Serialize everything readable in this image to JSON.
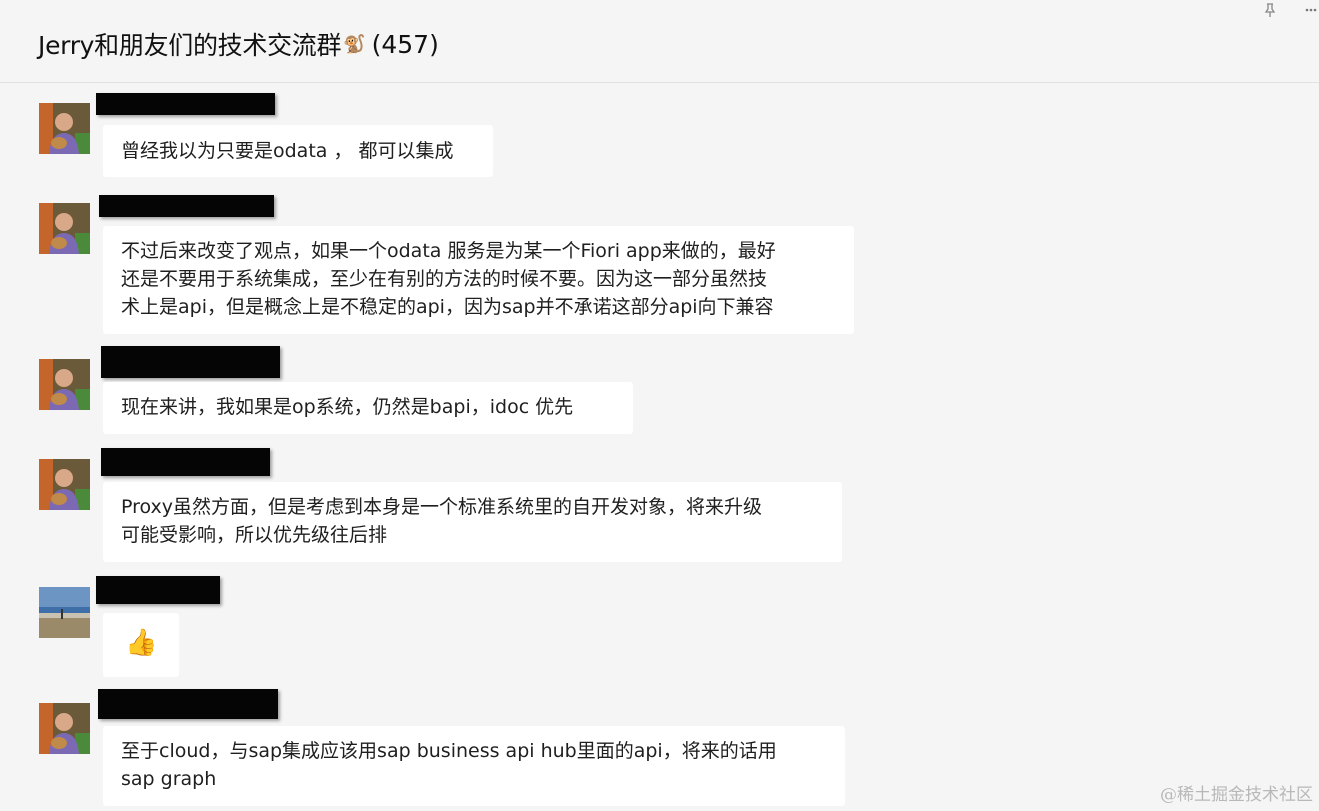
{
  "header": {
    "title": "Jerry和朋友们的技术交流群",
    "title_emoji": "🐒",
    "member_count": "(457)",
    "pin_icon": "pin-icon",
    "more_icon": "more-icon"
  },
  "messages": [
    {
      "avatar": "avatar-person-icon",
      "lines": [
        "曾经我以为只要是odata ， 都可以集成"
      ]
    },
    {
      "avatar": "avatar-person-icon",
      "lines": [
        "不过后来改变了观点，如果一个odata 服务是为某一个Fiori app来做的，最好",
        "还是不要用于系统集成，至少在有别的方法的时候不要。因为这一部分虽然技",
        "术上是api，但是概念上是不稳定的api，因为sap并不承诺这部分api向下兼容"
      ]
    },
    {
      "avatar": "avatar-person-icon",
      "lines": [
        "现在来讲，我如果是op系统，仍然是bapi，idoc 优先"
      ]
    },
    {
      "avatar": "avatar-person-icon",
      "lines": [
        "Proxy虽然方面，但是考虑到本身是一个标准系统里的自开发对象，将来升级",
        "可能受影响，所以优先级往后排"
      ]
    },
    {
      "avatar": "avatar-landscape-icon",
      "lines": [
        "👍"
      ]
    },
    {
      "avatar": "avatar-person-icon",
      "lines": [
        "至于cloud，与sap集成应该用sap business api hub里面的api，将来的话用",
        "sap graph"
      ]
    }
  ],
  "watermark": "@稀土掘金技术社区",
  "colors": {
    "background": "#f5f5f5",
    "bubble": "#ffffff",
    "redaction": "#050505"
  }
}
